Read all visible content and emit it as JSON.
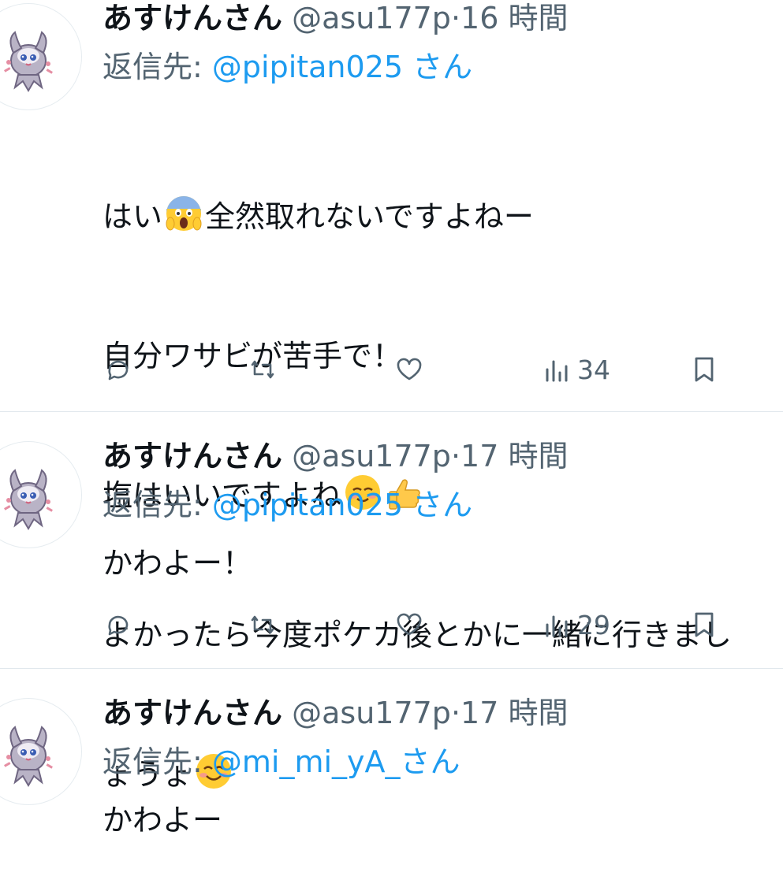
{
  "tweets": [
    {
      "name": "あすけんさん",
      "handle": "@asu177p",
      "separator": "·",
      "time": "16 時間",
      "reply_prefix": "返信先: ",
      "reply_mention": "@pipitan025",
      "reply_suffix": " さん",
      "lines": [
        "はい",
        "全然取れないですよねー",
        "自分ワサビが苦手で！",
        "塩はいいですよね",
        "よかったら今度ポケカ後とかに一緒に行きましょうょ"
      ],
      "views": "34"
    },
    {
      "name": "あすけんさん",
      "handle": "@asu177p",
      "separator": "·",
      "time": "17 時間",
      "reply_prefix": "返信先: ",
      "reply_mention": "@pipitan025",
      "reply_suffix": " さん",
      "text": "かわよー！",
      "views": "29"
    },
    {
      "name": "あすけんさん",
      "handle": "@asu177p",
      "separator": "·",
      "time": "17 時間",
      "reply_prefix": "返信先: ",
      "reply_mention": "@mi_mi_yA_",
      "reply_suffix": "さん",
      "text": "かわよー"
    }
  ],
  "icons": [
    "reply-icon",
    "retweet-icon",
    "like-icon",
    "views-icon",
    "bookmark-icon"
  ],
  "colors": {
    "accent": "#1d9bf0",
    "muted": "#536471",
    "text": "#0f1419",
    "divider": "#e1e8ed"
  }
}
